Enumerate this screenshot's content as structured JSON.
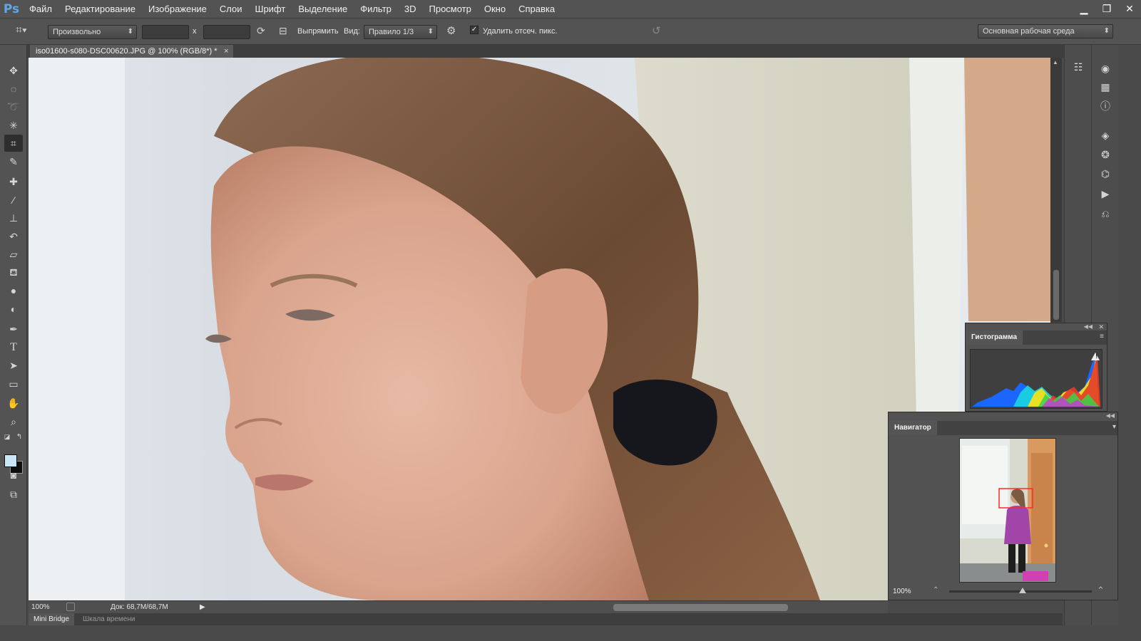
{
  "app": {
    "logo": "Ps"
  },
  "menu": [
    "Файл",
    "Редактирование",
    "Изображение",
    "Слои",
    "Шрифт",
    "Выделение",
    "Фильтр",
    "3D",
    "Просмотр",
    "Окно",
    "Справка"
  ],
  "window_controls": {
    "minimize": "▁",
    "restore": "❐",
    "close": "✕"
  },
  "options": {
    "ratio_value": "Произвольно",
    "width_value": "",
    "height_value": "",
    "times_sign": "x",
    "straighten_label": "Выпрямить",
    "view_label": "Вид:",
    "view_value": "Правило 1/3",
    "delete_cropped_checked": true,
    "delete_cropped_label": "Удалить отсеч. пикс.",
    "workspace_value": "Основная рабочая среда"
  },
  "document": {
    "tab_title": "iso01600-s080-DSC00620.JPG @ 100% (RGB/8*) *",
    "close": "×"
  },
  "status": {
    "zoom": "100%",
    "doc_info": "Док: 68,7M/68,7M",
    "arrow": "▶"
  },
  "bottom_tabs": [
    {
      "label": "Mini Bridge",
      "active": true
    },
    {
      "label": "Шкала времени",
      "active": false
    }
  ],
  "histogram": {
    "tab_label": "Гистограмма",
    "warning": "!"
  },
  "navigator": {
    "tab_label": "Навигатор",
    "zoom": "100%"
  },
  "tools": [
    "move-icon",
    "marquee-icon",
    "lasso-icon",
    "magic-wand-icon",
    "crop-icon",
    "eyedropper-icon",
    "healing-brush-icon",
    "brush-icon",
    "clone-stamp-icon",
    "history-brush-icon",
    "eraser-icon",
    "paint-bucket-icon",
    "blur-icon",
    "dodge-icon",
    "pen-icon",
    "type-icon",
    "path-select-icon",
    "rectangle-icon",
    "hand-icon",
    "zoom-icon"
  ],
  "colors": {
    "foreground": "#c8e8f8",
    "background": "#0e0e0e",
    "accent": "#5fa8e8"
  }
}
